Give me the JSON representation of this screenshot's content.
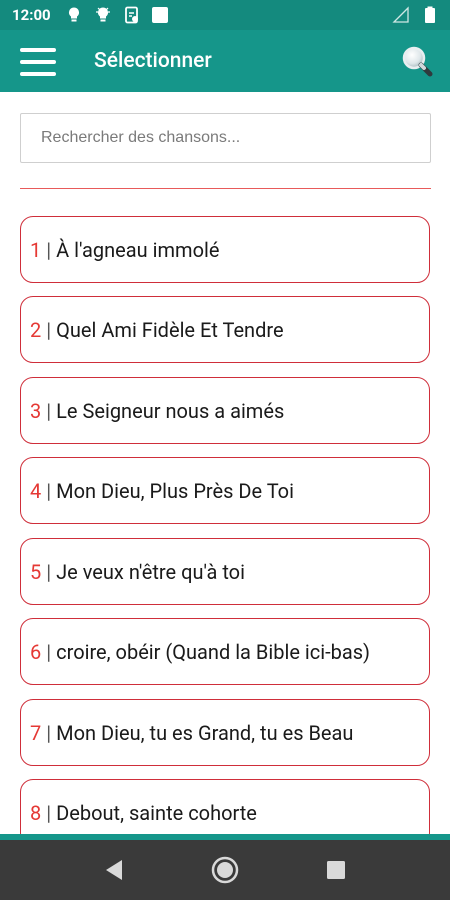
{
  "status_bar": {
    "time": "12:00",
    "icons": [
      "lightbulb-icon",
      "lightbulb-icon",
      "document-shield-icon",
      "square-notification-icon"
    ],
    "right_icons": [
      "signal-icon",
      "battery-icon"
    ]
  },
  "app_bar": {
    "title": "Sélectionner",
    "menu_icon": "hamburger-menu-icon",
    "search_icon": "magnifier-icon"
  },
  "search": {
    "placeholder": "Rechercher des chansons...",
    "value": ""
  },
  "songs": [
    {
      "number": "1",
      "separator": "|",
      "title": "À l'agneau immolé"
    },
    {
      "number": "2",
      "separator": "|",
      "title": "Quel Ami Fidèle Et Tendre"
    },
    {
      "number": "3",
      "separator": "|",
      "title": "Le Seigneur nous a aimés"
    },
    {
      "number": "4",
      "separator": "|",
      "title": "Mon Dieu, Plus Près De Toi"
    },
    {
      "number": "5",
      "separator": "|",
      "title": "Je veux n'être qu'à toi"
    },
    {
      "number": "6",
      "separator": "|",
      "title": "croire, obéir (Quand la Bible ici-bas)"
    },
    {
      "number": "7",
      "separator": "|",
      "title": "Mon Dieu, tu es Grand, tu es Beau"
    },
    {
      "number": "8",
      "separator": "|",
      "title": "Debout, sainte cohorte"
    }
  ],
  "nav_bar": {
    "back_icon": "back-triangle-icon",
    "home_icon": "home-circle-icon",
    "recents_icon": "recents-square-icon"
  },
  "colors": {
    "primary": "#15968A",
    "primary_dark": "#148A7E",
    "accent_red": "#E53935",
    "item_border": "#CF2E3A",
    "nav_bar": "#3A3A3A"
  }
}
